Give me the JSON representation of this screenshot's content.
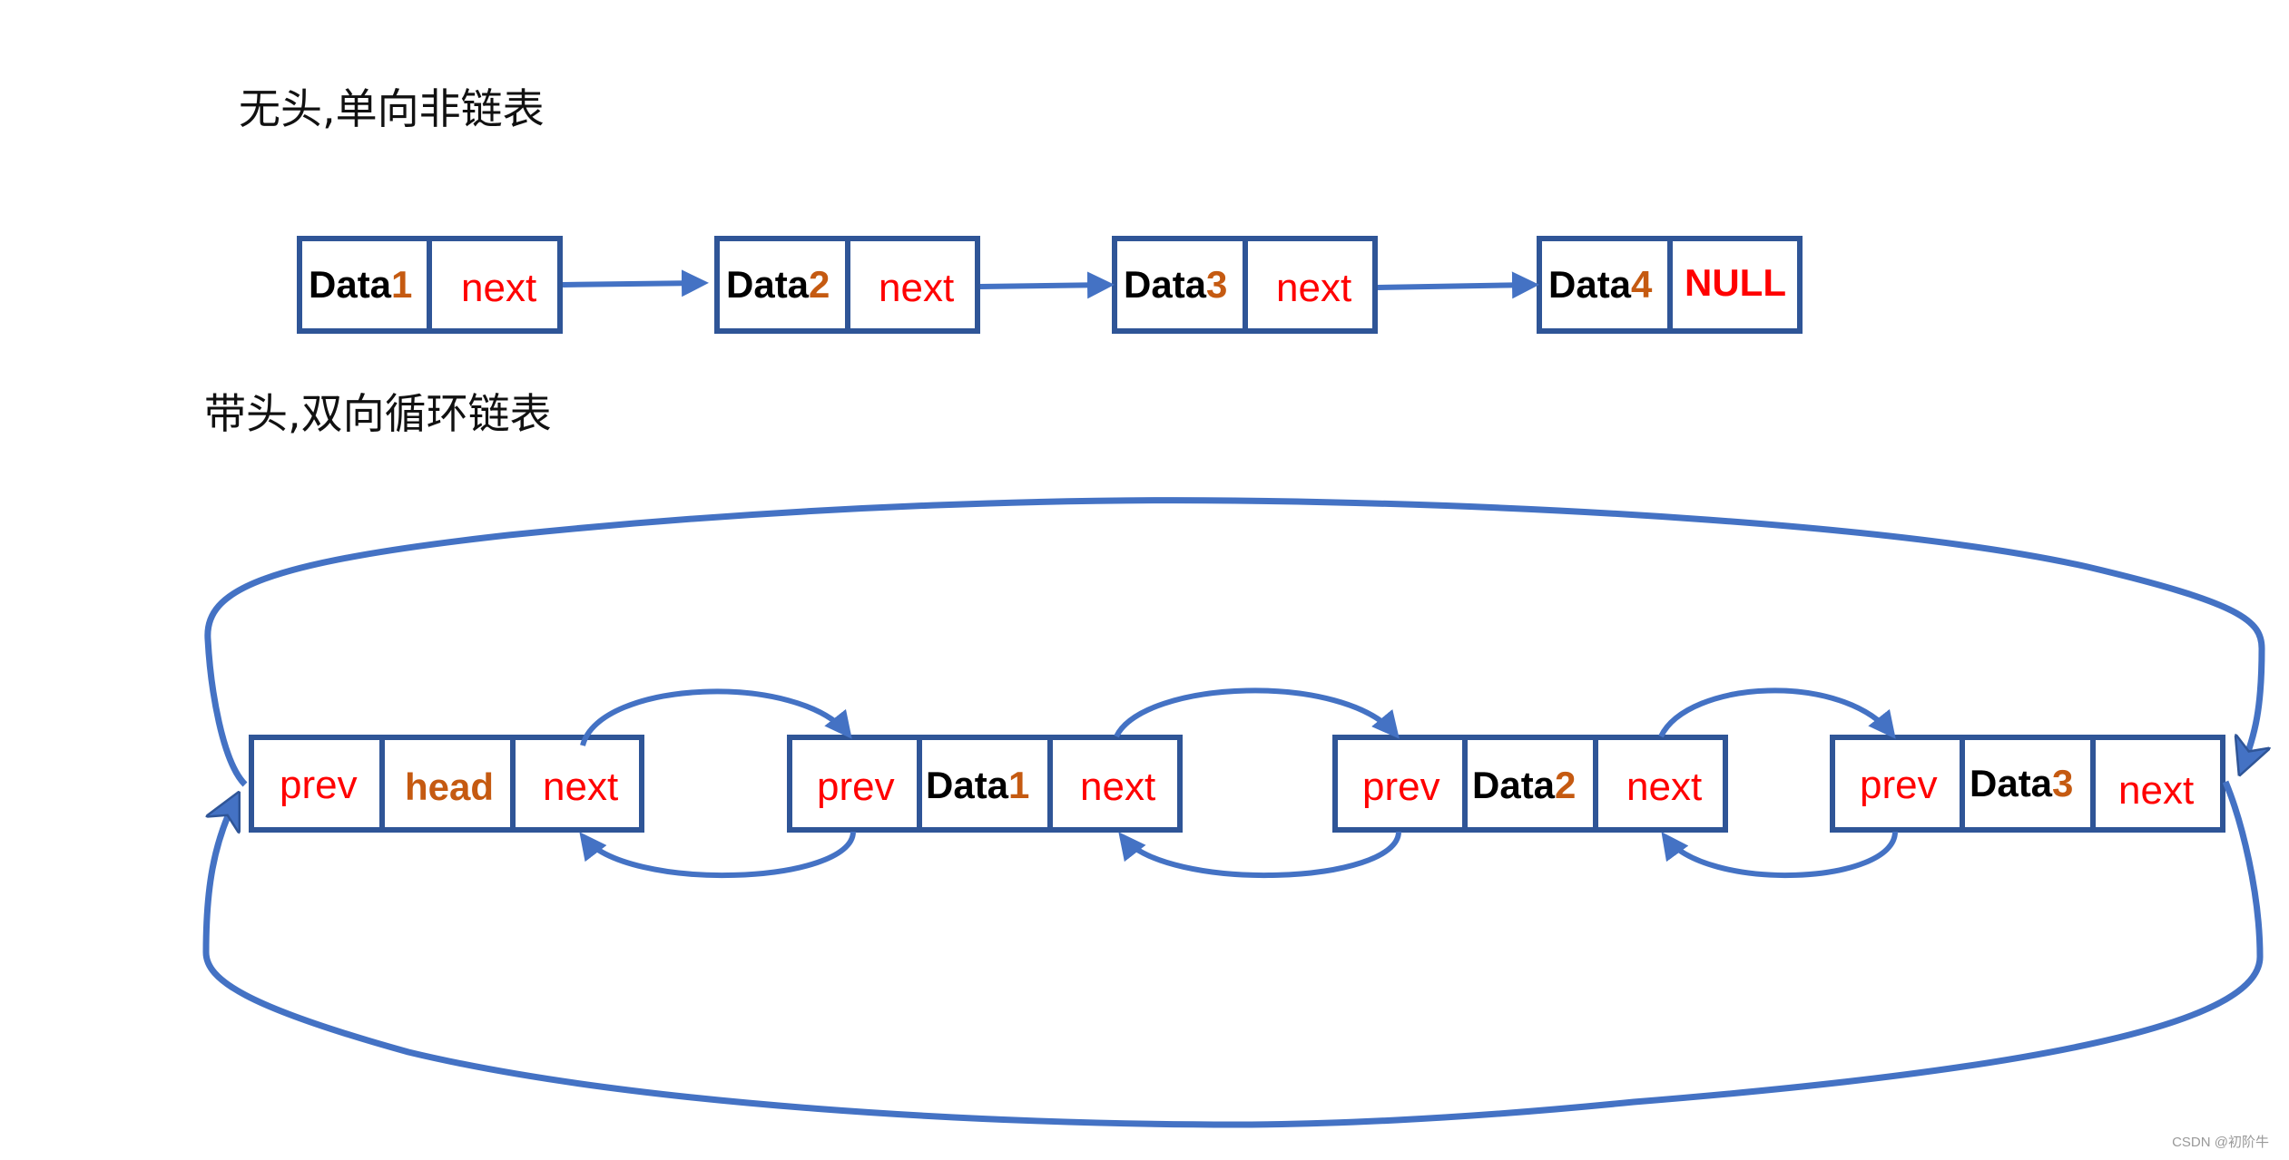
{
  "titles": {
    "singly": "无头,单向非链表",
    "doubly": "带头,双向循环链表"
  },
  "colors": {
    "box_border": "#2f5597",
    "arrow": "#4472c4",
    "pointer_text": "#ff0000",
    "index_text": "#c55a11",
    "data_text": "#000000"
  },
  "singly_list": {
    "nodes": [
      {
        "data_label": "Data",
        "index": "1",
        "pointer": "next"
      },
      {
        "data_label": "Data",
        "index": "2",
        "pointer": "next"
      },
      {
        "data_label": "Data",
        "index": "3",
        "pointer": "next"
      },
      {
        "data_label": "Data",
        "index": "4",
        "pointer": "NULL"
      }
    ]
  },
  "doubly_list": {
    "head": {
      "prev": "prev",
      "label": "head",
      "next": "next"
    },
    "nodes": [
      {
        "prev": "prev",
        "data_label": "Data",
        "index": "1",
        "next": "next"
      },
      {
        "prev": "prev",
        "data_label": "Data",
        "index": "2",
        "next": "next"
      },
      {
        "prev": "prev",
        "data_label": "Data",
        "index": "3",
        "next": "next"
      }
    ]
  },
  "watermark": "CSDN @初阶牛"
}
